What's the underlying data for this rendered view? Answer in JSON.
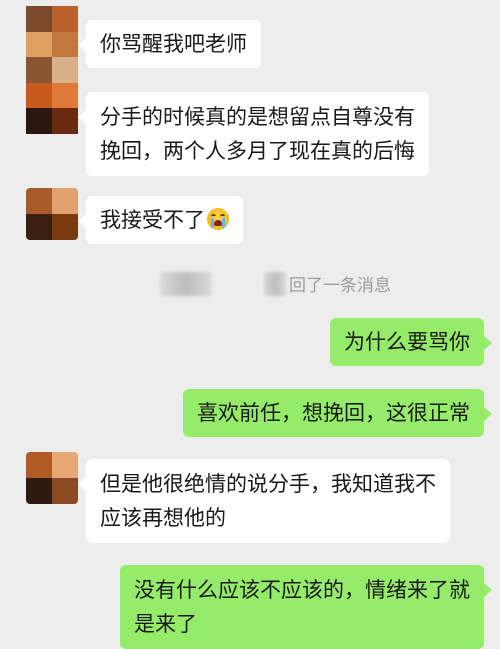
{
  "messages": [
    {
      "side": "left",
      "text": "你骂醒我吧老师"
    },
    {
      "side": "left",
      "lines": [
        "分手的时候真的是想留点自尊没有",
        "挽回，两个人多月了现在真的后悔"
      ]
    },
    {
      "side": "left",
      "text": "我接受不了",
      "emoji": "crying-face"
    },
    {
      "side": "right",
      "text": "为什么要骂你"
    },
    {
      "side": "right",
      "text": "喜欢前任，想挽回，这很正常"
    },
    {
      "side": "left",
      "lines": [
        "但是他很绝情的说分手，我知道我不",
        "应该再想他的"
      ]
    },
    {
      "side": "right",
      "lines": [
        "没有什么应该不应该的，情绪来了就",
        "是来了"
      ]
    }
  ],
  "recall_notice": "回了一条消息",
  "colors": {
    "background": "#ededed",
    "bubble_left": "#ffffff",
    "bubble_right": "#95ec69"
  }
}
